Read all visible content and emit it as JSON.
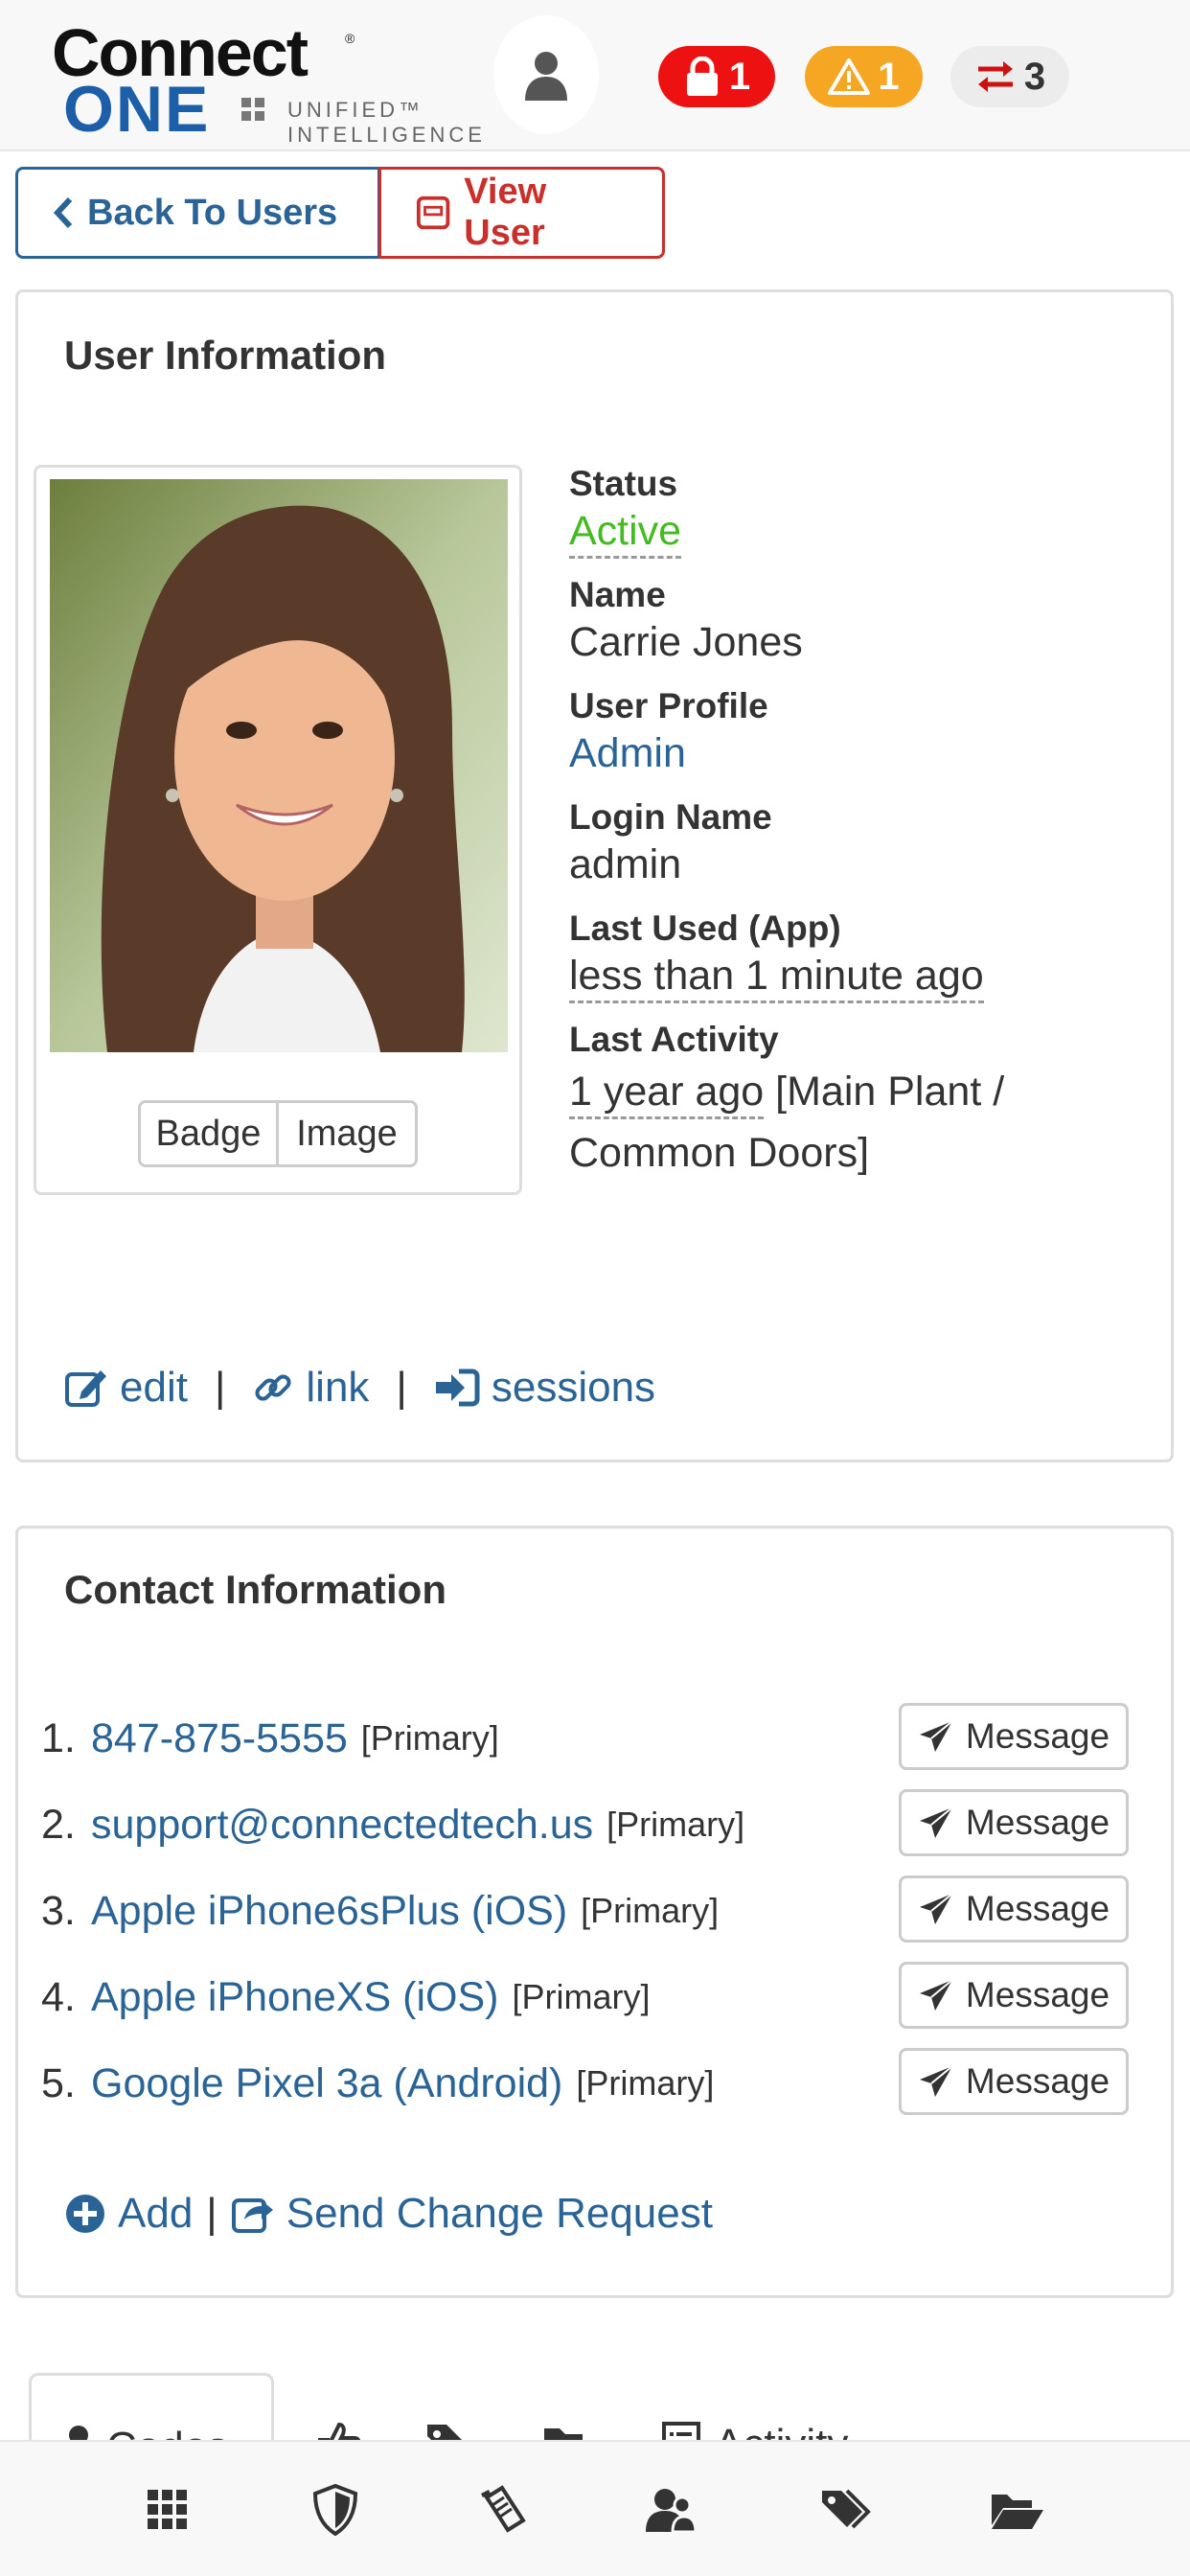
{
  "header": {
    "logo_connect": "Connect",
    "logo_reg": "®",
    "logo_one": "ONE",
    "logo_unified": "UNIFIED™",
    "logo_intelligence": "INTELLIGENCE",
    "lock_count": "1",
    "alert_count": "1",
    "transfer_count": "3",
    "colors": {
      "lock": "#ee1111",
      "alert": "#f5a623",
      "transfer": "#ececec"
    }
  },
  "toolbar": {
    "back_label": "Back To Users",
    "view_label": "View User"
  },
  "user_info": {
    "title": "User Information",
    "badge_label": "Badge",
    "image_label": "Image",
    "status_label": "Status",
    "status_value": "Active",
    "name_label": "Name",
    "name_value": "Carrie Jones",
    "profile_label": "User Profile",
    "profile_value": "Admin",
    "login_label": "Login Name",
    "login_value": "admin",
    "last_used_label": "Last Used (App)",
    "last_used_value": "less than 1 minute ago",
    "last_activity_label": "Last Activity",
    "last_activity_time": "1 year ago",
    "last_activity_place": "[Main Plant /",
    "last_activity_place2": "Common Doors]",
    "edit_label": "edit",
    "link_label": "link",
    "sessions_label": "sessions",
    "separator": "|"
  },
  "contact_info": {
    "title": "Contact Information",
    "items": [
      {
        "num": "1.",
        "value": "847-875-5555",
        "tag": "[Primary]",
        "button": "Message"
      },
      {
        "num": "2.",
        "value": "support@connectedtech.us",
        "tag": "[Primary]",
        "button": "Message"
      },
      {
        "num": "3.",
        "value": "Apple iPhone6sPlus (iOS)",
        "tag": "[Primary]",
        "button": "Message"
      },
      {
        "num": "4.",
        "value": "Apple iPhoneXS (iOS)",
        "tag": "[Primary]",
        "button": "Message"
      },
      {
        "num": "5.",
        "value": "Google Pixel 3a (Android)",
        "tag": "[Primary]",
        "button": "Message"
      }
    ],
    "add_label": "Add",
    "separator": "|",
    "change_request_label": "Send Change Request"
  },
  "tabs": {
    "codes_label": "Codes",
    "activity_label": "Activity"
  },
  "bottom_nav": {
    "icons": [
      "grid-icon",
      "shield-icon",
      "clipboard-icon",
      "users-icon",
      "tags-icon",
      "folder-open-icon"
    ]
  }
}
